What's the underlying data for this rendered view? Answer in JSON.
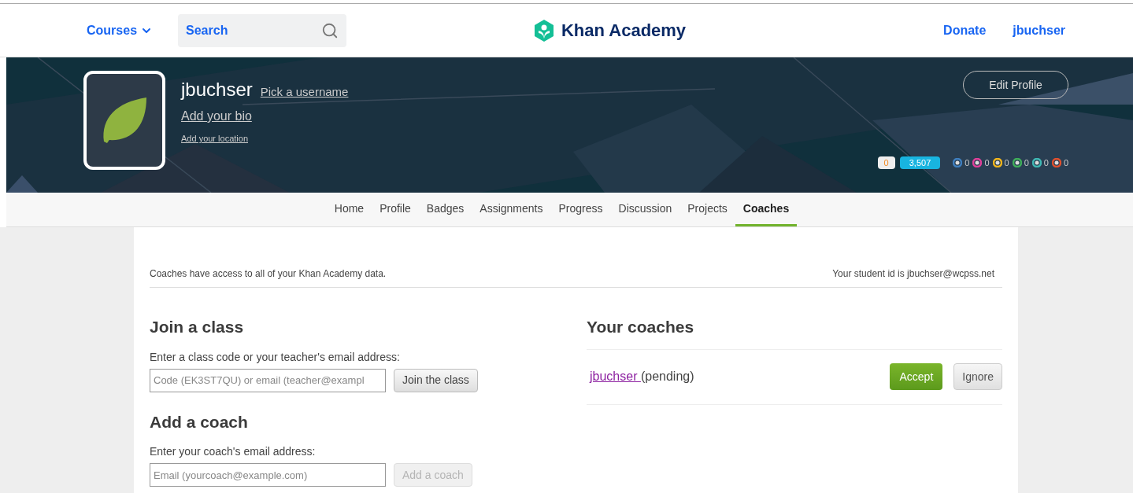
{
  "header": {
    "courses": "Courses",
    "search": {
      "placeholder": "Search"
    },
    "logo": "Khan Academy",
    "links": [
      "Donate",
      "jbuchser"
    ]
  },
  "profile": {
    "username": "jbuchser",
    "pick_username": "Pick a username",
    "add_bio": "Add your bio",
    "add_location": "Add your location",
    "edit_button": "Edit Profile",
    "streak": "0",
    "points": "3,507",
    "badges": [
      {
        "color": "#3f7fbf",
        "count": "0"
      },
      {
        "color": "#e0409a",
        "count": "0"
      },
      {
        "color": "#f2b51c",
        "count": "0"
      },
      {
        "color": "#3fae5a",
        "count": "0"
      },
      {
        "color": "#3fb8b4",
        "count": "0"
      },
      {
        "color": "#e0502e",
        "count": "0"
      }
    ]
  },
  "tabs": [
    {
      "label": "Home",
      "selected": false
    },
    {
      "label": "Profile",
      "selected": false
    },
    {
      "label": "Badges",
      "selected": false
    },
    {
      "label": "Assignments",
      "selected": false
    },
    {
      "label": "Progress",
      "selected": false
    },
    {
      "label": "Discussion",
      "selected": false
    },
    {
      "label": "Projects",
      "selected": false
    },
    {
      "label": "Coaches",
      "selected": true
    }
  ],
  "coaches_page": {
    "notice": "Coaches have access to all of your Khan Academy data.",
    "student_id": "Your student id is jbuchser@wcpss.net",
    "join_class": {
      "title": "Join a class",
      "label": "Enter a class code or your teacher's email address:",
      "placeholder": "Code (EK3ST7QU) or email (teacher@exampl",
      "button": "Join the class",
      "disabled": false
    },
    "add_coach": {
      "title": "Add a coach",
      "label": "Enter your coach's email address:",
      "placeholder": "Email (yourcoach@example.com)",
      "button": "Add a coach",
      "disabled": true
    },
    "your_coaches": {
      "title": "Your coaches",
      "coaches": [
        {
          "name": "jbuchser ",
          "status": "(pending)",
          "accept": "Accept",
          "ignore": "Ignore"
        }
      ]
    }
  }
}
